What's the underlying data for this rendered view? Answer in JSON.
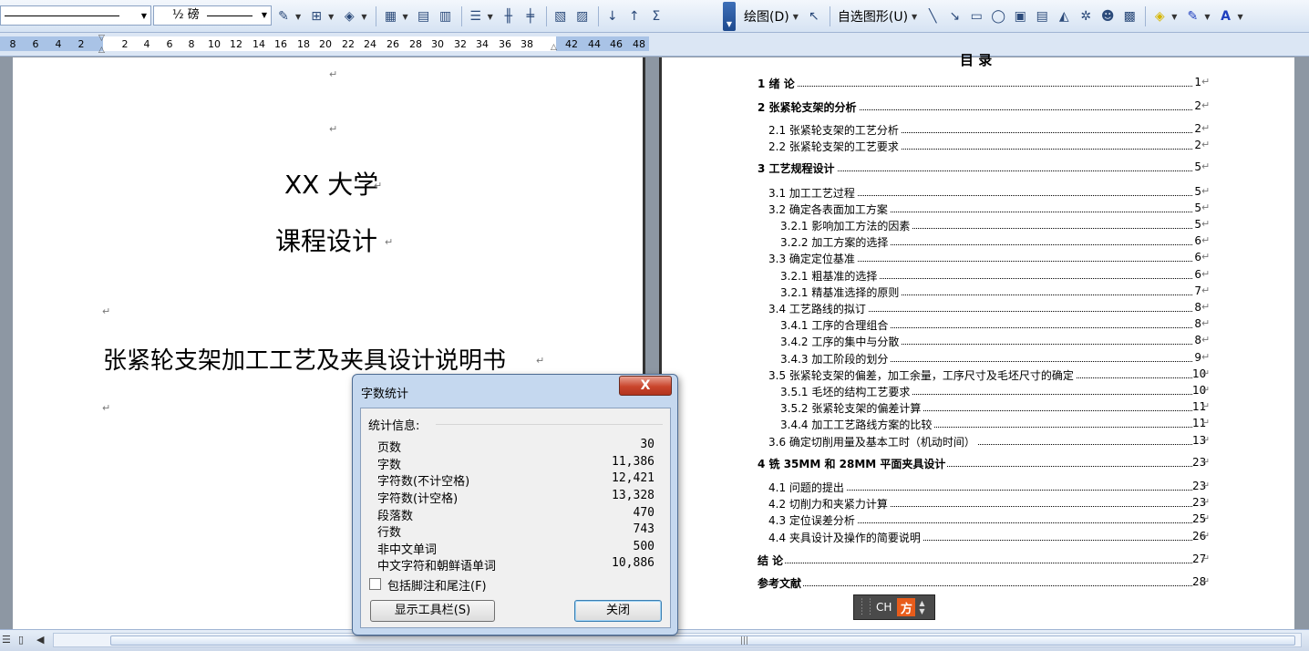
{
  "toolbar": {
    "line_weight": "½ 磅",
    "draw_menu": "绘图(D)",
    "autoshape_menu": "自选图形(U)",
    "sigma": "Σ"
  },
  "ruler": {
    "left_ticks": [
      "8",
      "6",
      "4",
      "2"
    ],
    "right_ticks": [
      "2",
      "4",
      "6",
      "8",
      "10",
      "12",
      "14",
      "16",
      "18",
      "20",
      "22",
      "24",
      "26",
      "28",
      "30",
      "32",
      "34",
      "36",
      "38",
      "42",
      "44",
      "46",
      "48"
    ]
  },
  "left_page": {
    "school": "XX 大学",
    "course": "课程设计",
    "doc_title": "张紧轮支架加工工艺及夹具设计说明书",
    "para_mark": "↵"
  },
  "right_page": {
    "toc_title": "目  录",
    "entries": [
      {
        "label": "1    绪  论",
        "page": "1"
      },
      {
        "label": "2    张紧轮支架的分析",
        "page": "2"
      },
      {
        "label": "2.1 张紧轮支架的工艺分析",
        "page": "2"
      },
      {
        "label": "2.2 张紧轮支架的工艺要求",
        "page": "2"
      },
      {
        "label": "3   工艺规程设计",
        "page": "5"
      },
      {
        "label": "3.1  加工工艺过程",
        "page": "5"
      },
      {
        "label": "3.2 确定各表面加工方案",
        "page": "5"
      },
      {
        "label": "3.2.1 影响加工方法的因素",
        "page": "5"
      },
      {
        "label": "3.2.2 加工方案的选择",
        "page": "6"
      },
      {
        "label": "3.3  确定定位基准",
        "page": "6"
      },
      {
        "label": "3.2.1 粗基准的选择",
        "page": "6"
      },
      {
        "label": "3.2.1  精基准选择的原则",
        "page": "7"
      },
      {
        "label": "3.4 工艺路线的拟订",
        "page": "8"
      },
      {
        "label": "3.4.1 工序的合理组合",
        "page": "8"
      },
      {
        "label": "3.4.2 工序的集中与分散",
        "page": "8"
      },
      {
        "label": "3.4.3 加工阶段的划分",
        "page": "9"
      },
      {
        "label": "3.5 张紧轮支架的偏差，加工余量，工序尺寸及毛坯尺寸的确定",
        "page": "10"
      },
      {
        "label": "3.5.1 毛坯的结构工艺要求",
        "page": "10"
      },
      {
        "label": "3.5.2 张紧轮支架的偏差计算",
        "page": "11"
      },
      {
        "label": "3.4.4 加工工艺路线方案的比较",
        "page": "11"
      },
      {
        "label": "3.6 确定切削用量及基本工时（机动时间）",
        "page": "13"
      },
      {
        "label": "4   铣 35MM 和 28MM 平面夹具设计",
        "page": "23"
      },
      {
        "label": "4.1  问题的提出",
        "page": "23"
      },
      {
        "label": "4.2  切削力和夹紧力计算",
        "page": "23"
      },
      {
        "label": "4.3  定位误差分析",
        "page": "25"
      },
      {
        "label": "4.4   夹具设计及操作的简要说明",
        "page": "26"
      },
      {
        "label": "结  论",
        "page": "27"
      },
      {
        "label": "参考文献",
        "page": "28"
      }
    ]
  },
  "ime": {
    "lang": "CH",
    "logo": "方"
  },
  "dialog": {
    "title": "字数统计",
    "close_glyph": "X",
    "section_label": "统计信息:",
    "stats": [
      {
        "label": "页数",
        "value": "30"
      },
      {
        "label": "字数",
        "value": "11,386"
      },
      {
        "label": "字符数(不计空格)",
        "value": "12,421"
      },
      {
        "label": "字符数(计空格)",
        "value": "13,328"
      },
      {
        "label": "段落数",
        "value": "470"
      },
      {
        "label": "行数",
        "value": "743"
      },
      {
        "label": "非中文单词",
        "value": "500"
      },
      {
        "label": "中文字符和朝鲜语单词",
        "value": "10,886"
      }
    ],
    "include_footnotes_label": "包括脚注和尾注(F)",
    "show_toolbar_label": "显示工具栏(S)",
    "close_label": "关闭"
  }
}
